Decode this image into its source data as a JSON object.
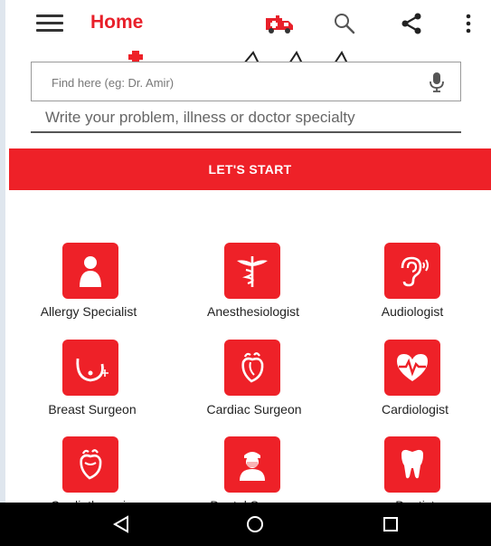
{
  "app_bar": {
    "title": "Home",
    "icons": [
      "menu-icon",
      "ambulance-icon",
      "search-icon",
      "share-icon",
      "more-vert-icon"
    ]
  },
  "search": {
    "placeholder": "Find here (eg: Dr. Amir)",
    "value": "",
    "helper_text": "Write your problem, illness or doctor specialty"
  },
  "start_button": {
    "label": "LET'S START"
  },
  "specialties": [
    {
      "label": "Allergy Specialist",
      "icon": "person-icon"
    },
    {
      "label": "Anesthesiologist",
      "icon": "caduceus-icon"
    },
    {
      "label": "Audiologist",
      "icon": "ear-icon"
    },
    {
      "label": "Breast Surgeon",
      "icon": "breast-icon"
    },
    {
      "label": "Cardiac Surgeon",
      "icon": "heart-organ-icon"
    },
    {
      "label": "Cardiologist",
      "icon": "heart-pulse-icon"
    },
    {
      "label": "Cardiothoracic",
      "icon": "heart-organ-icon"
    },
    {
      "label": "Dental Surgeon",
      "icon": "surgeon-icon"
    },
    {
      "label": "Dentist",
      "icon": "tooth-icon"
    }
  ],
  "nav_bar": {
    "icons": [
      "back-icon",
      "home-circle-icon",
      "recents-icon"
    ]
  },
  "colors": {
    "accent": "#ee2128",
    "title": "#e8202a",
    "nav": "#000000"
  }
}
